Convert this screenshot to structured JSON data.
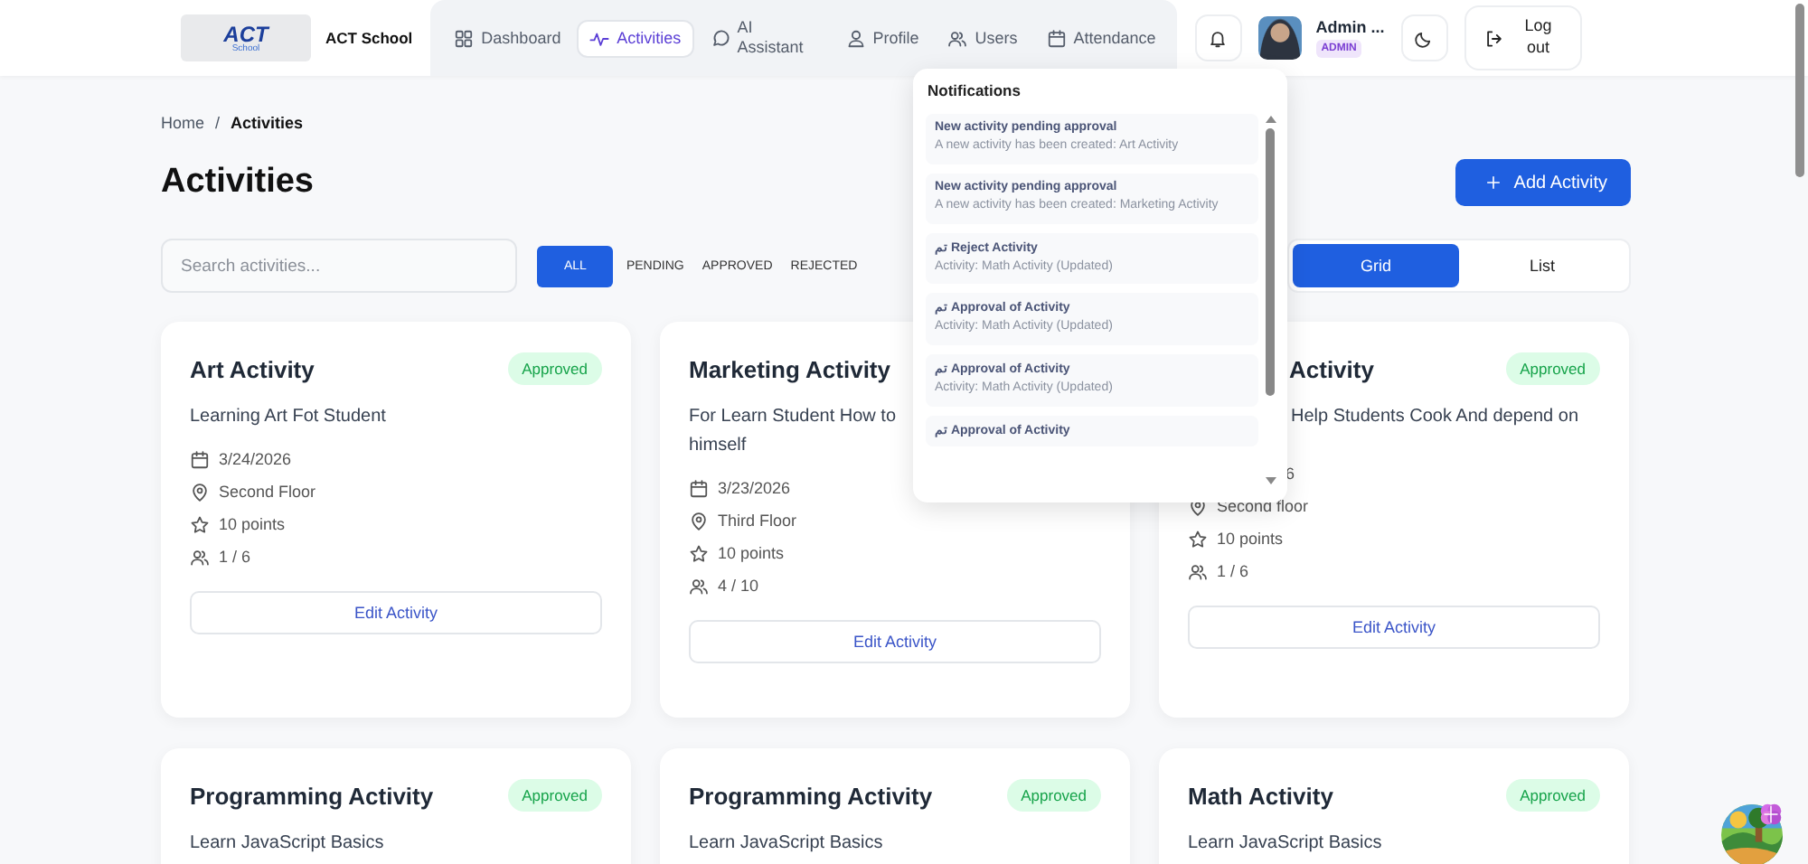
{
  "header": {
    "logo_text": "ACT",
    "logo_subtext": "School",
    "brand": "ACT School",
    "nav": [
      {
        "label": "Dashboard",
        "kind": "grid",
        "selected": false
      },
      {
        "label": "Activities",
        "kind": "pulse",
        "selected": true
      },
      {
        "label": "AI Assistant",
        "kind": "chat",
        "selected": false
      },
      {
        "label": "Profile",
        "kind": "user",
        "selected": false
      },
      {
        "label": "Users",
        "kind": "users",
        "selected": false
      },
      {
        "label": "Attendance",
        "kind": "calendar",
        "selected": false
      }
    ],
    "user": {
      "name": "Admin ...",
      "role": "ADMIN"
    },
    "logout": "Log out"
  },
  "breadcrumb": {
    "items": [
      "Home",
      "Activities"
    ],
    "separator": "/"
  },
  "page_title": "Activities",
  "add_button": "Add Activity",
  "search": {
    "placeholder": "Search activities..."
  },
  "filters": [
    {
      "label": "ALL",
      "selected": true
    },
    {
      "label": "PENDING",
      "selected": false
    },
    {
      "label": "APPROVED",
      "selected": false
    },
    {
      "label": "REJECTED",
      "selected": false
    }
  ],
  "view_toggle": [
    {
      "label": "Grid",
      "selected": true
    },
    {
      "label": "List",
      "selected": false
    }
  ],
  "cards": [
    {
      "kind": "full",
      "title": "Art Activity",
      "status": {
        "label": "Approved",
        "kind": "approved"
      },
      "description": [
        "Learning Art Fot Student"
      ],
      "meta": [
        {
          "kind": "calendar",
          "text": "3/24/2026"
        },
        {
          "kind": "pin",
          "text": "Second Floor"
        },
        {
          "kind": "star",
          "text": "10 points"
        },
        {
          "kind": "users",
          "text": "1 / 6"
        }
      ],
      "action": "Edit Activity"
    },
    {
      "kind": "full",
      "title": "Marketing Activity",
      "description": [
        "For Learn Student How to",
        "himself"
      ],
      "meta": [
        {
          "kind": "calendar",
          "text": "3/23/2026"
        },
        {
          "kind": "pin",
          "text": "Third Floor"
        },
        {
          "kind": "star",
          "text": "10 points"
        },
        {
          "kind": "users",
          "text": "4 / 10"
        }
      ],
      "action": "Edit Activity"
    },
    {
      "kind": "overlapped",
      "title": "Activity",
      "status": {
        "label": "Approved",
        "kind": "approved"
      },
      "description": [
        "Help Students Cook And depend on"
      ],
      "meta": [
        {
          "kind": "bare",
          "text": "6"
        },
        {
          "kind": "pin",
          "text": "Second floor"
        },
        {
          "kind": "star",
          "text": "10 points"
        },
        {
          "kind": "users",
          "text": "1 / 6"
        }
      ],
      "action": "Edit Activity"
    },
    {
      "kind": "full",
      "title": "Programming Activity",
      "status": {
        "label": "Approved",
        "kind": "approved"
      },
      "description": [
        "Learn JavaScript Basics"
      ]
    },
    {
      "kind": "full",
      "title": "Programming Activity",
      "status": {
        "label": "Approved",
        "kind": "approved"
      },
      "description": [
        "Learn JavaScript Basics"
      ]
    },
    {
      "kind": "full",
      "title": "Math Activity",
      "status": {
        "label": "Approved",
        "kind": "approved"
      },
      "description": [
        "Learn JavaScript Basics"
      ]
    }
  ],
  "notifications": {
    "title": "Notifications",
    "items": [
      {
        "title": "New activity pending approval",
        "body": "A new activity has been created: Art Activity"
      },
      {
        "title": "New activity pending approval",
        "body": "A new activity has been created: Marketing Activity"
      },
      {
        "title": "تم Reject Activity",
        "body": "Activity: Math Activity (Updated)"
      },
      {
        "title": "تم Approval of Activity",
        "body": "Activity: Math Activity (Updated)"
      },
      {
        "title": "تم Approval of Activity",
        "body": "Activity: Math Activity (Updated)"
      },
      {
        "title": "تم Approval of Activity"
      }
    ]
  }
}
